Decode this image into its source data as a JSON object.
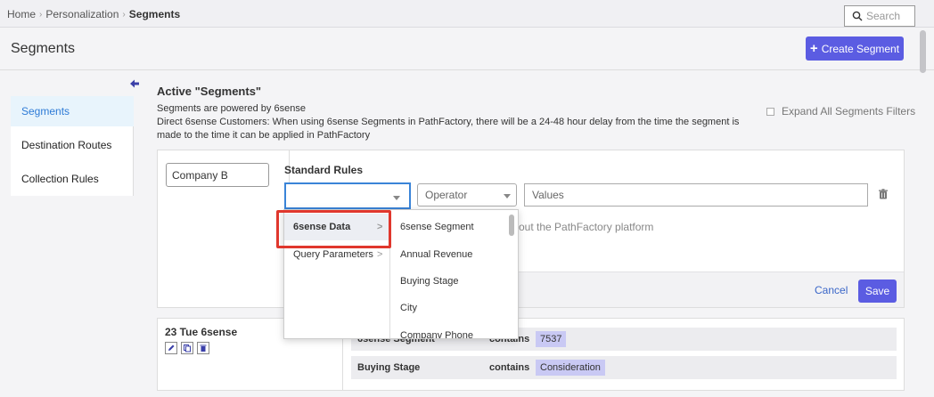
{
  "breadcrumb": {
    "home": "Home",
    "personalization": "Personalization",
    "current": "Segments"
  },
  "search": {
    "placeholder": "Search"
  },
  "header": {
    "title": "Segments",
    "create_button": "Create Segment"
  },
  "sidebar": {
    "items": [
      {
        "label": "Segments",
        "active": true
      },
      {
        "label": "Destination Routes",
        "active": false
      },
      {
        "label": "Collection Rules",
        "active": false
      }
    ]
  },
  "main": {
    "title": "Active \"Segments\"",
    "powered_by": "Segments are powered by 6sense",
    "notice": "Direct 6sense Customers: When using 6sense Segments in PathFactory, there will be a 24-48 hour delay from the time the segment is made to the time it can be applied in PathFactory",
    "expand_all_label": "Expand All Segments Filters"
  },
  "editor": {
    "segment_name": "Company B",
    "rules_title": "Standard Rules",
    "attribute_value": "",
    "operator_placeholder": "Operator",
    "values_placeholder": "Values",
    "hint_fragment": "out the PathFactory platform",
    "cancel_label": "Cancel",
    "save_label": "Save"
  },
  "dropdown": {
    "categories": [
      {
        "label": "6sense Data",
        "highlighted": true
      },
      {
        "label": "Query Parameters",
        "highlighted": false
      }
    ],
    "items": [
      "6sense Segment",
      "Annual Revenue",
      "Buying Stage",
      "City",
      "Company Phone"
    ]
  },
  "saved_segment": {
    "title": "23 Tue 6sense",
    "rules": [
      {
        "attribute": "6sense Segment",
        "operator": "contains",
        "value": "7537"
      },
      {
        "attribute": "Buying Stage",
        "operator": "contains",
        "value": "Consideration"
      }
    ]
  },
  "colors": {
    "accent": "#5b5ce2",
    "active_sidebar_bg": "#e8f4fc",
    "active_sidebar_text": "#2e7bd6",
    "highlight_border": "#e0372d",
    "value_chip": "#c9c9f4"
  }
}
